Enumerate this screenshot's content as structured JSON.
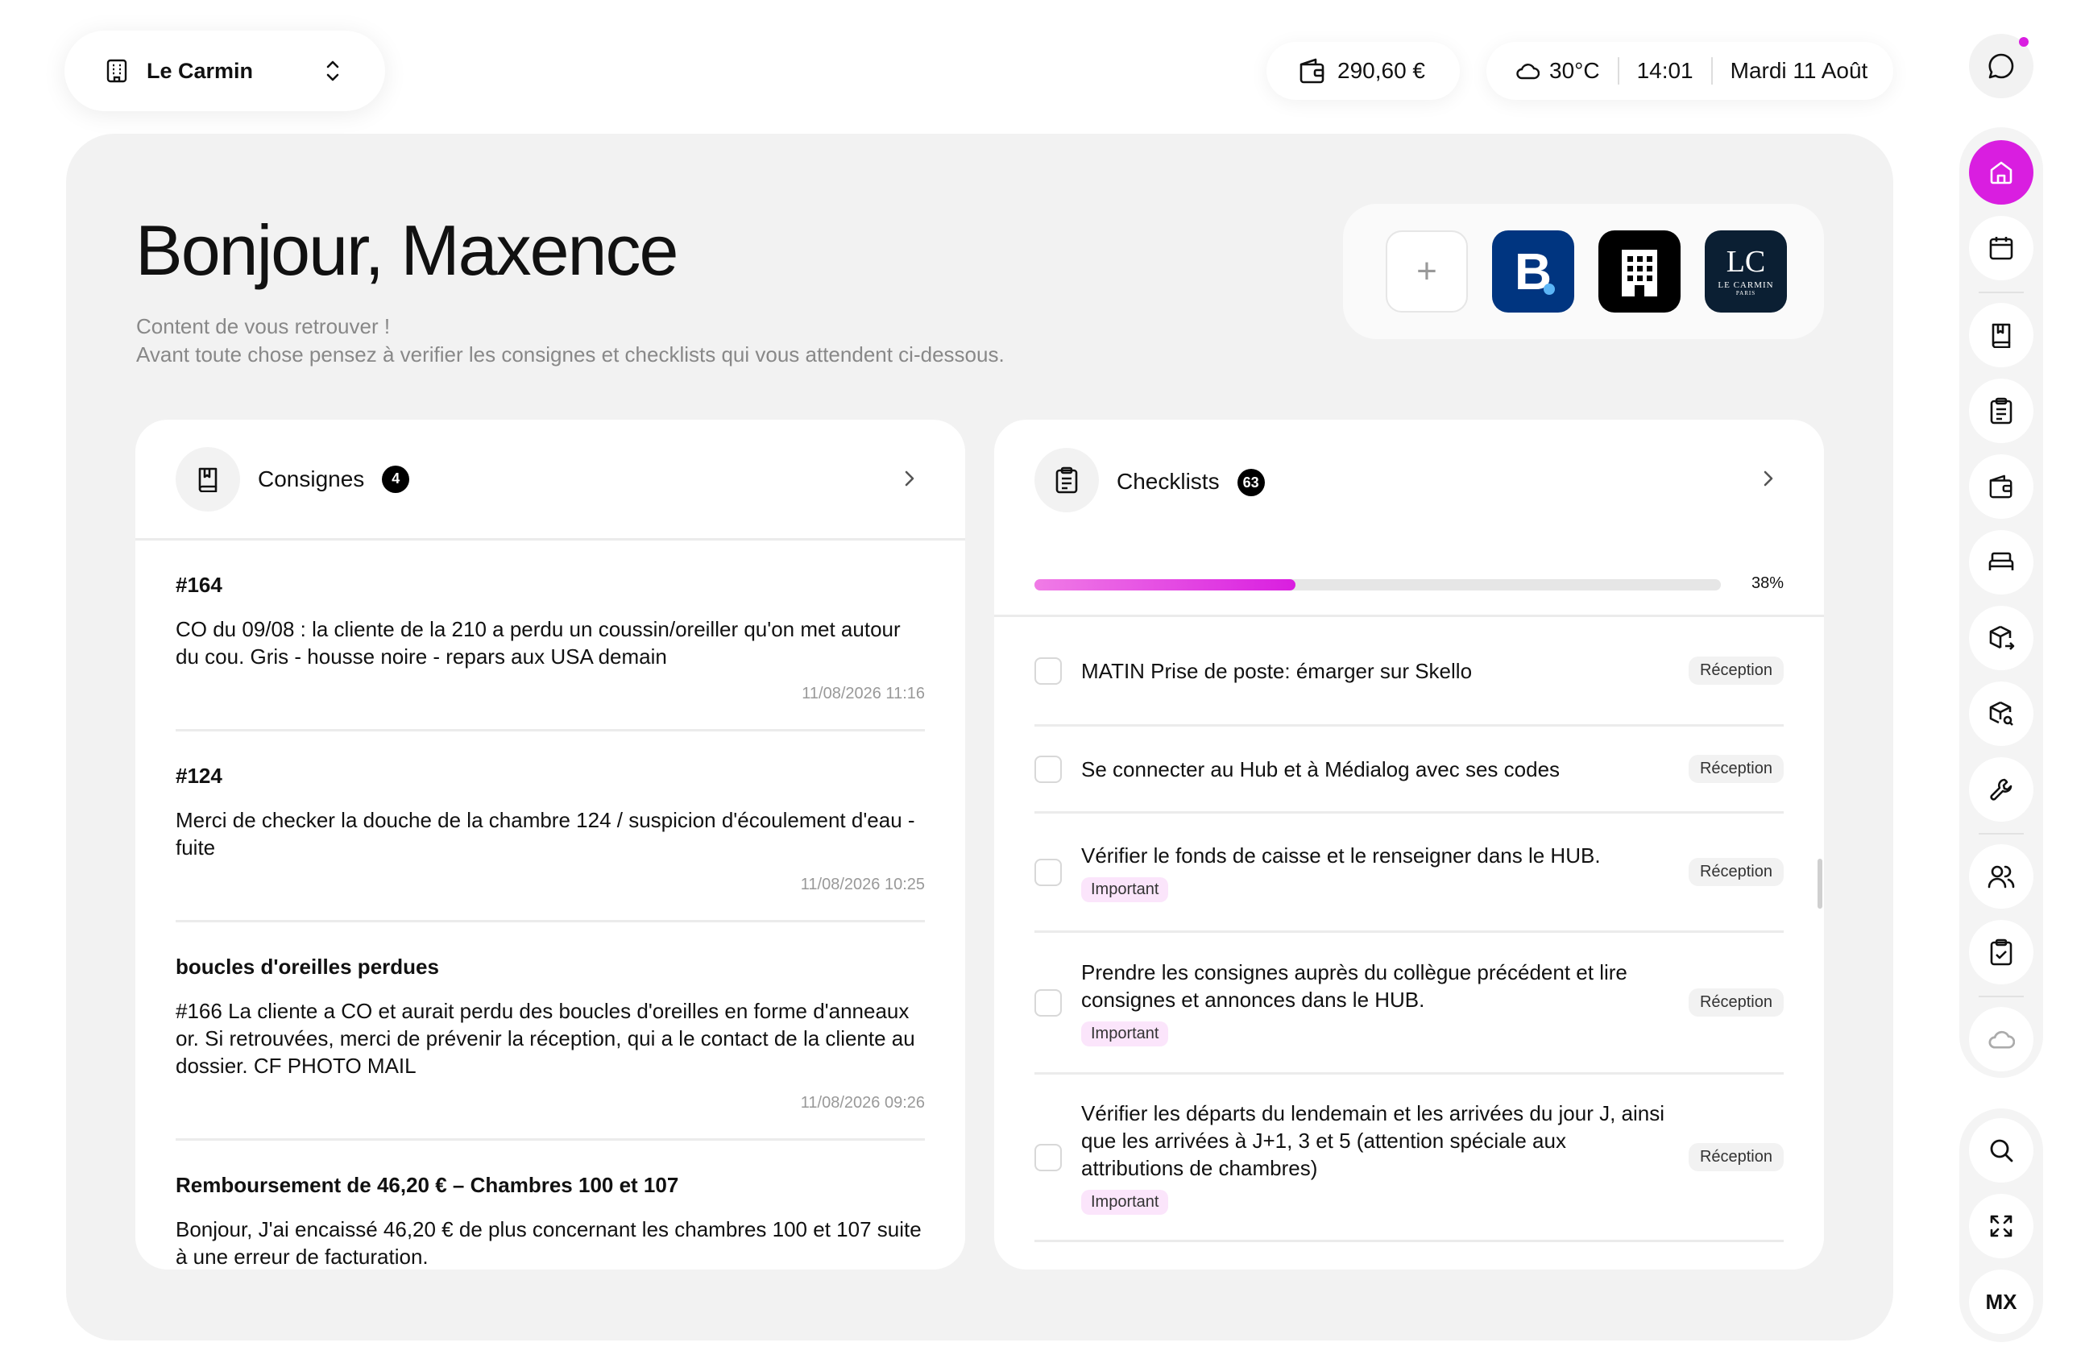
{
  "topbar": {
    "hotel_name": "Le Carmin",
    "balance": "290,60 €",
    "temperature": "30°C",
    "time": "14:01",
    "date": "Mardi 11 Août"
  },
  "greeting": {
    "title": "Bonjour, Maxence",
    "line1": "Content de vous retrouver !",
    "line2": "Avant toute chose pensez à verifier les consignes et checklists qui vous attendent ci-dessous."
  },
  "apps": {
    "add": "+",
    "booking": "B",
    "lc_big": "LC",
    "lc_small": "LE CARMIN",
    "lc_tiny": "PARIS"
  },
  "consignes": {
    "title": "Consignes",
    "count": "4",
    "items": [
      {
        "title": "#164",
        "body": "CO du 09/08 : la cliente de la 210 a perdu un coussin/oreiller qu'on met autour du cou. Gris - housse noire - repars aux USA demain",
        "date": "11/08/2026 11:16"
      },
      {
        "title": "#124",
        "body": "Merci de checker la douche de la chambre 124 / suspicion d'écoulement d'eau - fuite",
        "date": "11/08/2026 10:25"
      },
      {
        "title": "boucles d'oreilles perdues",
        "body": "#166 La cliente a CO et aurait perdu des boucles d'oreilles en forme d'anneaux or. Si retrouvées, merci de prévenir la réception, qui a le contact de la cliente au dossier. CF PHOTO MAIL",
        "date": "11/08/2026 09:26"
      },
      {
        "title": "Remboursement de 46,20 € – Chambres 100 et 107",
        "body": "Bonjour, J'ai encaissé 46,20 € de plus concernant les chambres 100 et 107 suite à une erreur de facturation.",
        "date": ""
      }
    ]
  },
  "checklists": {
    "title": "Checklists",
    "count": "63",
    "progress_pct": 38,
    "progress_label": "38%",
    "items": [
      {
        "text": "MATIN Prise de poste: émarger sur Skello",
        "badge": "",
        "tag": "Réception"
      },
      {
        "text": "Se connecter au Hub et à Médialog avec ses codes",
        "badge": "",
        "tag": "Réception"
      },
      {
        "text": "Vérifier le fonds de caisse et le renseigner dans le HUB.",
        "badge": "Important",
        "tag": "Réception"
      },
      {
        "text": "Prendre les consignes auprès du collègue précédent et lire consignes et annonces dans le HUB.",
        "badge": "Important",
        "tag": "Réception"
      },
      {
        "text": "Vérifier les départs du lendemain et les arrivées du jour J, ainsi que les arrivées à J+1, 3 et 5 (attention spéciale aux attributions de chambres)",
        "badge": "Important",
        "tag": "Réception"
      }
    ]
  },
  "sidebar": {
    "user_initials": "MX"
  },
  "colors": {
    "accent": "#d91ee0",
    "booking": "#003580",
    "panel": "#f2f2f2"
  }
}
